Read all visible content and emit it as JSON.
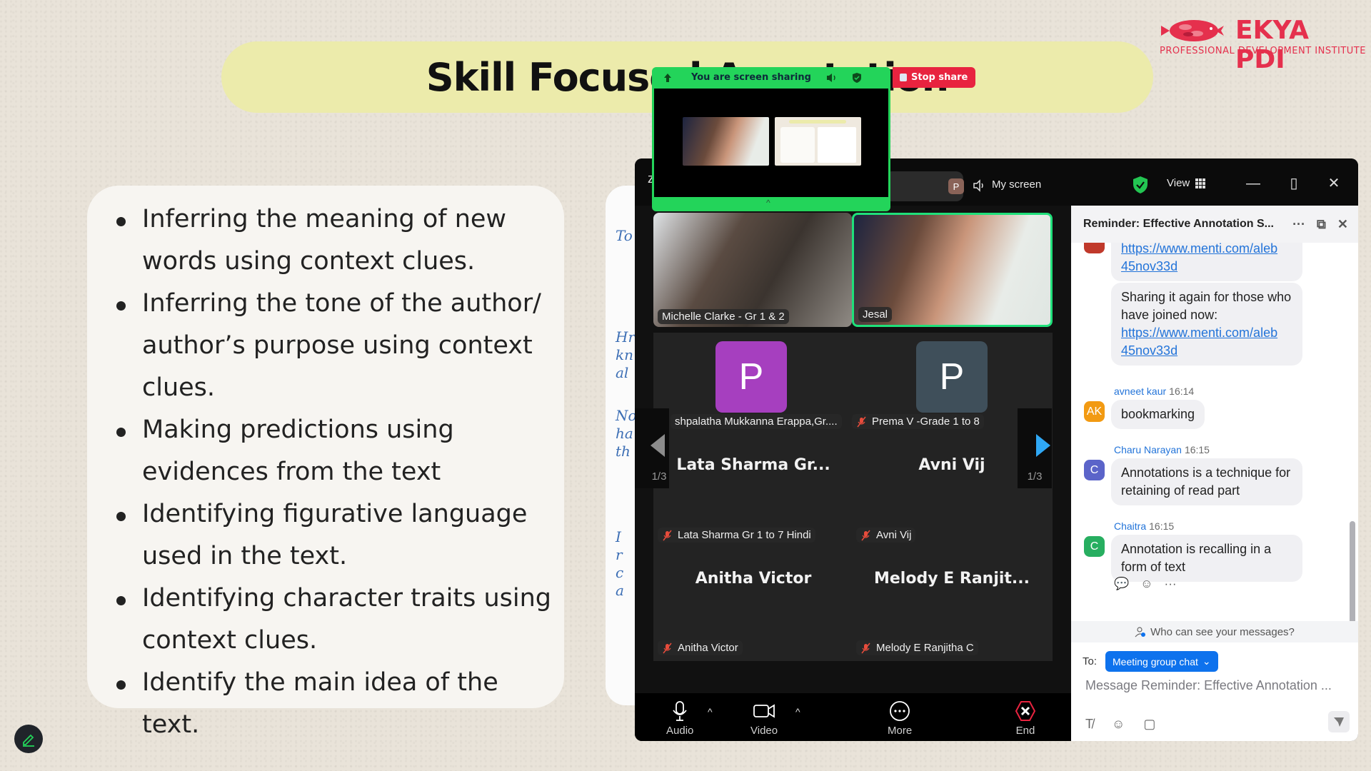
{
  "slide": {
    "title": "Skill Focused Annotation",
    "logo": {
      "name": "EKYA PDI",
      "subtitle": "PROFESSIONAL DEVELOPMENT INSTITUTE",
      "color": "#e5304d"
    },
    "bullets": [
      "Inferring the meaning of new words using context clues.",
      "Inferring the tone of the author/ author’s purpose using context clues.",
      "Making predictions using evidences from the text",
      "Identifying figurative language used in the text.",
      "Identifying character traits using context clues.",
      "Identify the main idea of the text."
    ],
    "doc_fragments": [
      "To",
      "Hr",
      "kn",
      "al",
      "No",
      "ha",
      "th",
      "I",
      "r",
      "c",
      "a"
    ],
    "pen_button_icon": "pencil-icon"
  },
  "screen_share": {
    "status": "You are screen sharing",
    "stop_label": "Stop share",
    "accent": "#23d45a",
    "stop_color": "#e8233f"
  },
  "zoom_window": {
    "title_stub": "z",
    "speaker_initial": "P",
    "speaker_label": "My screen",
    "view_label": "View",
    "gallery": {
      "video_tiles": [
        {
          "name": "Michelle Clarke - Gr 1 & 2",
          "active": false
        },
        {
          "name": "Jesal",
          "active": true
        }
      ],
      "avatar_tiles": [
        {
          "initial": "P",
          "name": "shpalatha Mukkanna Erappa,Gr....",
          "color": "#a63fbf",
          "muted": false
        },
        {
          "initial": "P",
          "name": "Prema V  -Grade  1 to 8",
          "color": "#3f4f5a",
          "muted": true
        }
      ],
      "name_tiles": [
        {
          "display": "Lata Sharma Gr...",
          "name": "Lata Sharma Gr 1 to 7 Hindi",
          "muted": true
        },
        {
          "display": "Avni Vij",
          "name": "Avni Vij",
          "muted": true
        },
        {
          "display": "Anitha Victor",
          "name": "Anitha Victor",
          "muted": true
        },
        {
          "display": "Melody  E  Ranjit...",
          "name": "Melody E Ranjitha C",
          "muted": true
        }
      ],
      "page_left": "1/3",
      "page_right": "1/3"
    },
    "toolbar": {
      "audio": "Audio",
      "video": "Video",
      "more": "More",
      "end": "End"
    }
  },
  "chat": {
    "title": "Reminder: Effective Annotation S...",
    "messages": [
      {
        "link_partial": "https://www.menti.com/aleb",
        "link_tail": "45nov33d"
      },
      {
        "text": "Sharing it again for those who have joined now:",
        "link": "https://www.menti.com/aleb",
        "link_tail": "45nov33d"
      },
      {
        "sender": "avneet kaur",
        "time": "16:14",
        "initials": "AK",
        "color": "#f29a12",
        "text": "bookmarking"
      },
      {
        "sender": "Charu Narayan",
        "time": "16:15",
        "initials": "C",
        "color": "#5b64c9",
        "text": "Annotations is a technique for retaining of read part"
      },
      {
        "sender": "Chaitra",
        "time": "16:15",
        "initials": "C",
        "color": "#27ae60",
        "text": "Annotation is recalling in a form of text"
      }
    ],
    "privacy_note": "Who can see your messages?",
    "to_label": "To:",
    "recipient": "Meeting group chat",
    "input_placeholder": "Message Reminder: Effective Annotation ..."
  }
}
